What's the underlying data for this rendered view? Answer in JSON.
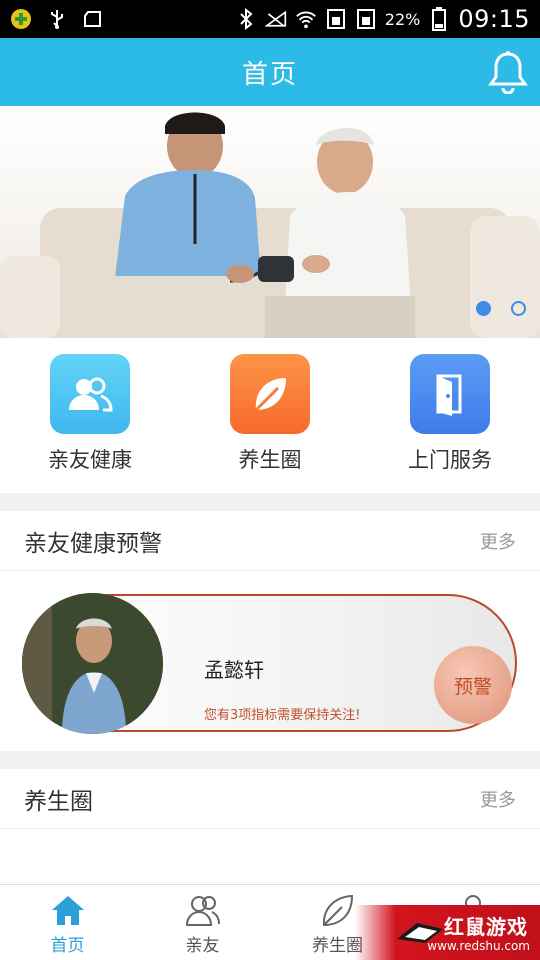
{
  "status_bar": {
    "battery_pct": "22%",
    "time": "09:15",
    "icons": [
      "app-badge-icon",
      "usb-icon",
      "clipboard-icon",
      "bluetooth-icon",
      "no-signal-icon",
      "wifi-icon",
      "sim-icon",
      "sim2-icon",
      "battery-icon"
    ]
  },
  "header": {
    "title": "首页",
    "icon": "bell-icon"
  },
  "banner": {
    "slide_count": 2,
    "active_slide": 1
  },
  "quick_actions": [
    {
      "label": "亲友健康",
      "icon": "people-icon",
      "color": "#4fc6f3"
    },
    {
      "label": "养生圈",
      "icon": "leaf-icon",
      "color": "#fb7a36"
    },
    {
      "label": "上门服务",
      "icon": "door-icon",
      "color": "#4f8af2"
    }
  ],
  "health_alert": {
    "title": "亲友健康预警",
    "more": "更多",
    "card": {
      "name": "孟懿轩",
      "message": "您有3项指标需要保持关注!",
      "button": "预警"
    }
  },
  "wellness": {
    "title": "养生圈",
    "more": "更多"
  },
  "bottom_nav": [
    {
      "label": "首页",
      "icon": "home-icon",
      "active": true
    },
    {
      "label": "亲友",
      "icon": "friends-icon",
      "active": false
    },
    {
      "label": "养生圈",
      "icon": "leaf-outline-icon",
      "active": false
    },
    {
      "label": "",
      "icon": "profile-icon",
      "active": false
    }
  ],
  "watermark": {
    "text": "红鼠游戏",
    "url": "www.redshu.com"
  },
  "colors": {
    "header": "#2bbbe6",
    "accent": "#2a9fd8",
    "alert": "#b84a2a"
  }
}
